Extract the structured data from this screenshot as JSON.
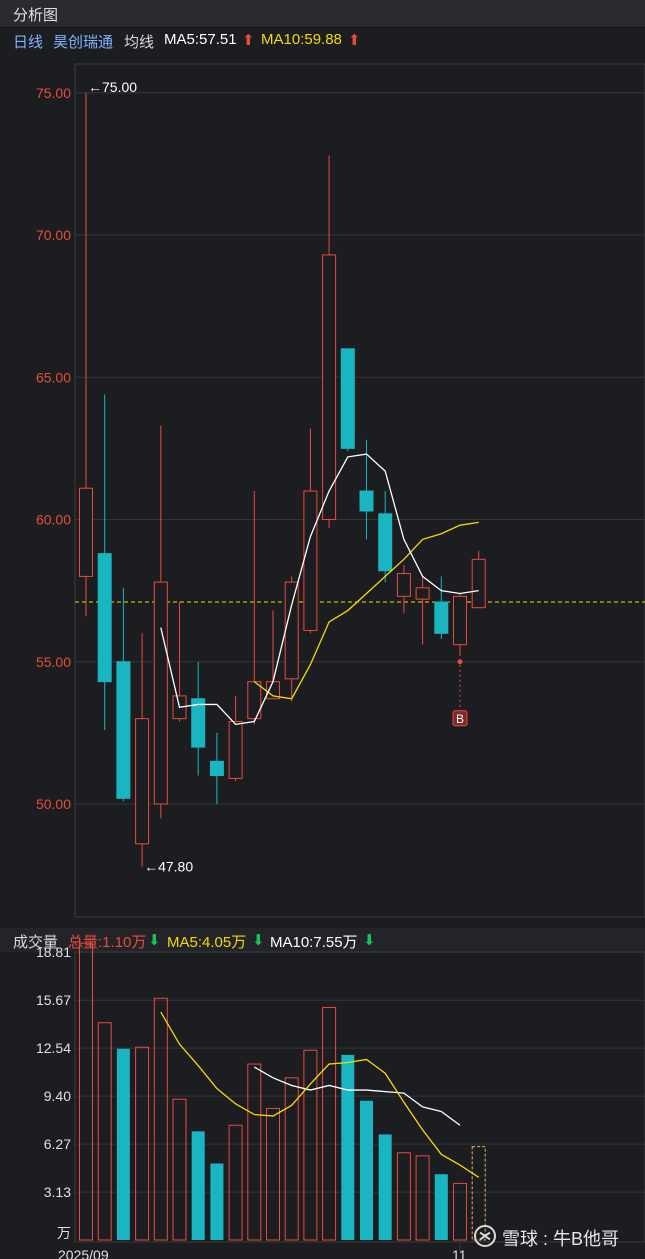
{
  "header": {
    "title": "分析图"
  },
  "price_legend": {
    "period": "日线",
    "stock": "昊创瑞通",
    "indicator": "均线",
    "ma5": "MA5:57.51",
    "ma10": "MA10:59.88",
    "up_arrow": "⬆"
  },
  "volume_legend": {
    "title": "成交量",
    "total": "总量:1.10万",
    "ma5": "MA5:4.05万",
    "ma10": "MA10:7.55万",
    "down_arrow": "⬇"
  },
  "colors": {
    "up": "#e84b3c",
    "down": "#19b6c2",
    "ma5_line": "#ffffff",
    "ma10_line": "#f5d90a",
    "label_red": "#e84b3c",
    "label_yellow": "#f5d90a",
    "label_blue": "#7fb4ff"
  },
  "chart_data": [
    {
      "type": "candlestick",
      "y_ticks": [
        "75.00",
        "70.00",
        "65.00",
        "60.00",
        "55.00",
        "50.00"
      ],
      "ylim": [
        46.5,
        76.0
      ],
      "annotations": {
        "high": "←75.00",
        "low": "←47.80",
        "buy_marker": "B"
      },
      "reference_price": 57.1,
      "candles": [
        {
          "o": 58.0,
          "h": 75.0,
          "l": 56.6,
          "c": 61.1
        },
        {
          "o": 58.8,
          "h": 64.4,
          "l": 52.6,
          "c": 54.3
        },
        {
          "o": 55.0,
          "h": 57.6,
          "l": 50.1,
          "c": 50.2
        },
        {
          "o": 48.6,
          "h": 56.0,
          "l": 47.8,
          "c": 53.0
        },
        {
          "o": 50.0,
          "h": 63.3,
          "l": 49.5,
          "c": 57.8
        },
        {
          "o": 53.0,
          "h": 57.1,
          "l": 52.9,
          "c": 53.8
        },
        {
          "o": 53.7,
          "h": 55.0,
          "l": 51.0,
          "c": 52.0
        },
        {
          "o": 51.5,
          "h": 52.5,
          "l": 50.0,
          "c": 51.0
        },
        {
          "o": 50.9,
          "h": 53.8,
          "l": 50.8,
          "c": 52.9
        },
        {
          "o": 53.0,
          "h": 61.0,
          "l": 52.8,
          "c": 54.3
        },
        {
          "o": 53.7,
          "h": 56.8,
          "l": 53.7,
          "c": 54.3
        },
        {
          "o": 54.4,
          "h": 58.0,
          "l": 53.6,
          "c": 57.8
        },
        {
          "o": 56.1,
          "h": 63.2,
          "l": 56.0,
          "c": 61.0
        },
        {
          "o": 60.0,
          "h": 72.8,
          "l": 59.7,
          "c": 69.3
        },
        {
          "o": 66.0,
          "h": 66.0,
          "l": 62.4,
          "c": 62.5
        },
        {
          "o": 61.0,
          "h": 62.8,
          "l": 59.3,
          "c": 60.3
        },
        {
          "o": 60.2,
          "h": 61.0,
          "l": 57.8,
          "c": 58.2
        },
        {
          "o": 57.3,
          "h": 58.4,
          "l": 56.7,
          "c": 58.1
        },
        {
          "o": 57.2,
          "h": 58.0,
          "l": 55.6,
          "c": 57.6
        },
        {
          "o": 57.1,
          "h": 58.0,
          "l": 55.8,
          "c": 56.0
        },
        {
          "o": 55.6,
          "h": 57.4,
          "l": 55.2,
          "c": 57.3
        },
        {
          "o": 56.9,
          "h": 58.9,
          "l": 56.9,
          "c": 58.6
        }
      ],
      "ma5": [
        null,
        null,
        null,
        null,
        56.2,
        53.4,
        53.5,
        53.5,
        52.8,
        52.9,
        54.3,
        57.0,
        59.4,
        61.0,
        62.2,
        62.3,
        61.7,
        59.3,
        58.0,
        57.5,
        57.4,
        57.5
      ],
      "ma10": [
        null,
        null,
        null,
        null,
        null,
        null,
        null,
        null,
        null,
        54.3,
        53.8,
        53.7,
        54.9,
        56.4,
        56.8,
        57.4,
        58.0,
        58.6,
        59.3,
        59.5,
        59.8,
        59.9
      ],
      "ma5_color": "#ffffff",
      "ma10_color": "#f5d90a",
      "buy_index": 20,
      "buy_price": 55.0
    },
    {
      "type": "bar",
      "y_ticks": [
        "18.81",
        "15.67",
        "12.54",
        "9.40",
        "6.27",
        "3.13"
      ],
      "y_unit": "万",
      "ylim": [
        0,
        19.5
      ],
      "x_labels": [
        "2025/09",
        "11"
      ],
      "bars": [
        {
          "v": 19.4,
          "dir": "up"
        },
        {
          "v": 14.2,
          "dir": "up"
        },
        {
          "v": 12.5,
          "dir": "down"
        },
        {
          "v": 12.6,
          "dir": "up"
        },
        {
          "v": 15.8,
          "dir": "up"
        },
        {
          "v": 9.2,
          "dir": "up"
        },
        {
          "v": 7.1,
          "dir": "down"
        },
        {
          "v": 5.0,
          "dir": "down"
        },
        {
          "v": 7.5,
          "dir": "up"
        },
        {
          "v": 11.5,
          "dir": "up"
        },
        {
          "v": 8.6,
          "dir": "up"
        },
        {
          "v": 10.6,
          "dir": "up"
        },
        {
          "v": 12.4,
          "dir": "up"
        },
        {
          "v": 15.2,
          "dir": "up"
        },
        {
          "v": 12.1,
          "dir": "down"
        },
        {
          "v": 9.1,
          "dir": "down"
        },
        {
          "v": 6.9,
          "dir": "down"
        },
        {
          "v": 5.7,
          "dir": "up"
        },
        {
          "v": 5.5,
          "dir": "up"
        },
        {
          "v": 4.3,
          "dir": "down"
        },
        {
          "v": 3.7,
          "dir": "up"
        },
        {
          "v": 6.1,
          "dir": "pending"
        }
      ],
      "ma5": [
        null,
        null,
        null,
        null,
        14.9,
        12.8,
        11.4,
        9.9,
        8.9,
        8.2,
        8.1,
        8.8,
        10.2,
        11.5,
        11.6,
        11.8,
        10.9,
        9.0,
        7.2,
        5.6,
        4.9,
        4.1
      ],
      "ma10": [
        null,
        null,
        null,
        null,
        null,
        null,
        null,
        null,
        null,
        11.3,
        10.6,
        10.1,
        9.8,
        10.1,
        9.8,
        9.8,
        9.7,
        9.6,
        8.7,
        8.4,
        7.5
      ],
      "ma5_color": "#f5d90a",
      "ma10_color": "#ffffff"
    }
  ],
  "watermark": {
    "brand": "雪球",
    "author": "牛B他哥"
  }
}
